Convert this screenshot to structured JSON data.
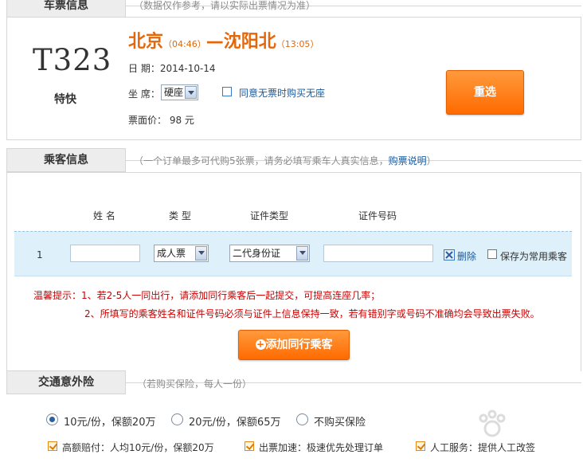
{
  "ticket_section": {
    "tab_label": "车票信息",
    "note": "（数据仅作参考，请以实际出票情况为准）"
  },
  "ticket": {
    "train_number": "T323",
    "train_type": "特快",
    "from_station": "北京",
    "from_time": "04:46",
    "dash": "—",
    "to_station": "沈阳北",
    "to_time": "13:05",
    "date_label": "日  期：",
    "date_value": "2014-10-14",
    "seat_label": "坐  席：",
    "seat_value": "硬座",
    "standing_option": "同意无票时购买无座",
    "price_label": "票面价：",
    "price_value": "98 元",
    "reselect_button": "重选"
  },
  "passenger_section": {
    "tab_label": "乘客信息",
    "note_prefix": "（一个订单最多可代购5张票，请务必填写乘车人真实信息，",
    "note_link": "购票说明",
    "note_suffix": "）"
  },
  "passenger_table": {
    "headers": [
      "姓  名",
      "类  型",
      "证件类型",
      "证件号码"
    ],
    "row": {
      "index": "1",
      "name_value": "",
      "type_value": "成人票",
      "id_type_value": "二代身份证",
      "id_number_value": "",
      "delete_label": "删除",
      "save_label": "保存为常用乘客"
    }
  },
  "tips": {
    "line1": "温馨提示：1、若2-5人一同出行，请添加同行乘客后一起提交，可提高连座几率；",
    "line2": "2、所填写的乘客姓名和证件号码必须与证件上信息保持一致，若有错别字或号码不准确均会导致出票失败。"
  },
  "add_passenger_button": "添加同行乘客",
  "insurance_section": {
    "tab_label": "交通意外险",
    "note": "（若购买保险，每人一份）",
    "options": [
      {
        "label": "10元/份，保额20万",
        "selected": true
      },
      {
        "label": "20元/份，保额65万",
        "selected": false
      },
      {
        "label": "不购买保险",
        "selected": false
      }
    ],
    "services": [
      {
        "label": "高额赔付：人均10元/份，保额20万",
        "checked": true
      },
      {
        "label": "出票加速：极速优先处理订单",
        "checked": true
      },
      {
        "label": "人工服务：提供人工改签",
        "checked": true
      }
    ]
  },
  "colors": {
    "accent_orange": "#ff6a00",
    "route_orange": "#e4680b",
    "warning_red": "#cc0000",
    "link_blue": "#1a5a9c",
    "row_highlight": "#def0fa"
  }
}
